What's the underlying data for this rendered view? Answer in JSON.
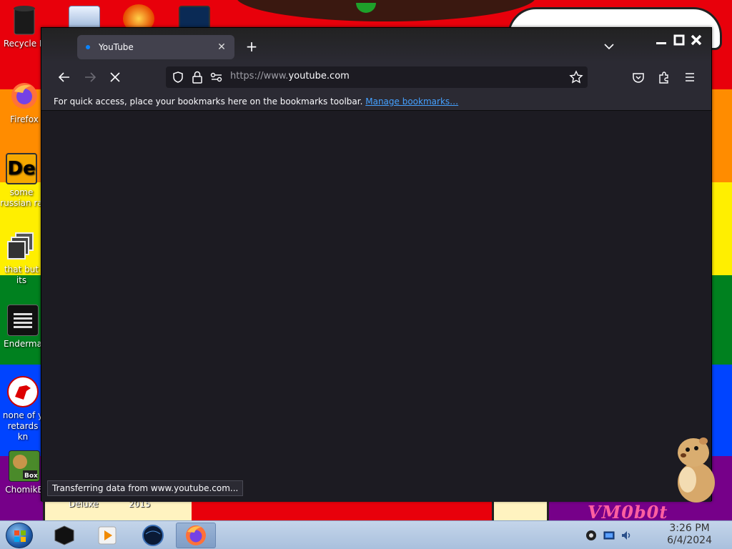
{
  "desktop": {
    "icons": [
      {
        "label": "Recycle B"
      },
      {
        "label": "Firefox"
      },
      {
        "label": "some\nrussian ra"
      },
      {
        "label": "that but its"
      },
      {
        "label": "Enderma"
      },
      {
        "label": "none of y\nretards kn"
      },
      {
        "label": "ChomikB"
      }
    ],
    "under_labels": [
      "Deluxe",
      "2015"
    ],
    "watermark": "VM0b0t"
  },
  "browser": {
    "tab": {
      "title": "YouTube"
    },
    "url": {
      "prefix": "https://www.",
      "host": "youtube.com"
    },
    "bookmarks_bar": {
      "message": "For quick access, place your bookmarks here on the bookmarks toolbar.",
      "link": "Manage bookmarks…"
    },
    "status": "Transferring data from www.youtube.com..."
  },
  "taskbar": {
    "clock": {
      "time": "3:26 PM",
      "date": "6/4/2024"
    }
  },
  "colors": {
    "accent": "#0a84ff",
    "link": "#45a1ff",
    "browser_bg": "#1c1b22",
    "toolbar_bg": "#2b2a33"
  }
}
